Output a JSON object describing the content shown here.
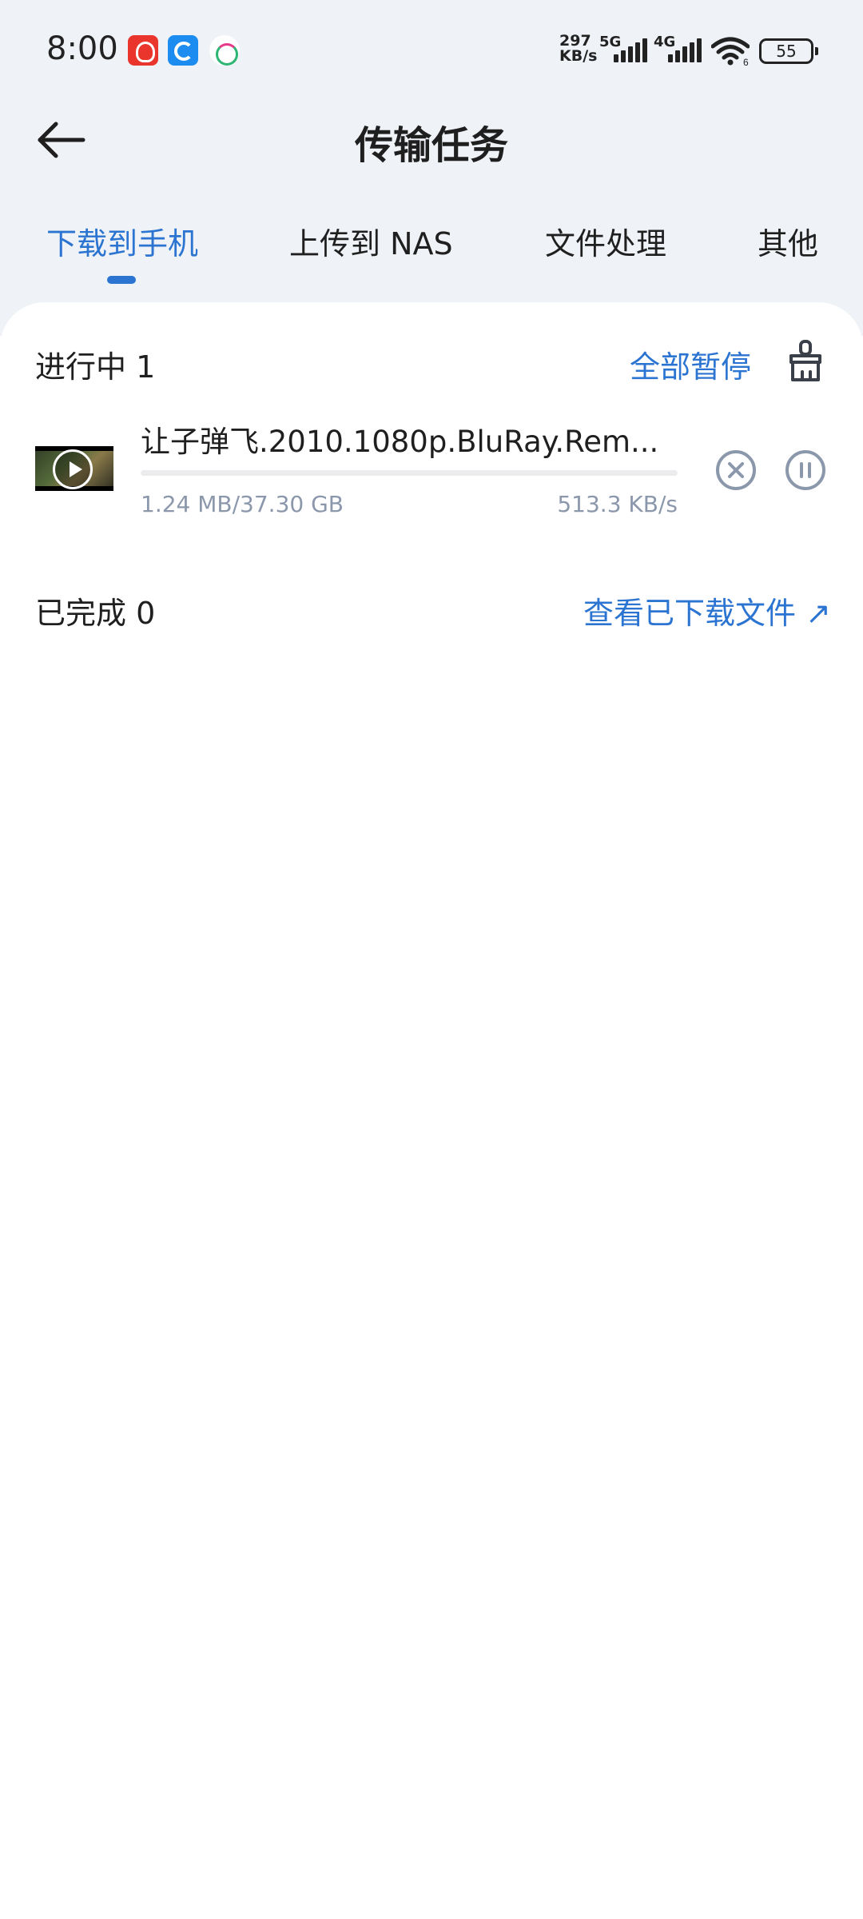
{
  "status_bar": {
    "time": "8:00",
    "net_speed_value": "297",
    "net_speed_unit": "KB/s",
    "sim1_label": "5G",
    "sim2_label": "4G",
    "wifi_slot": "6",
    "battery": "55"
  },
  "header": {
    "title": "传输任务"
  },
  "tabs": [
    {
      "label": "下载到手机",
      "active": true
    },
    {
      "label": "上传到 NAS",
      "active": false
    },
    {
      "label": "文件处理",
      "active": false
    },
    {
      "label": "其他",
      "active": false
    }
  ],
  "in_progress": {
    "title": "进行中 1",
    "pause_all_label": "全部暂停",
    "clean_icon": "broom-icon",
    "tasks": [
      {
        "name": "让子弹飞.2010.1080p.BluRay.Rem...",
        "size_text": "1.24 MB/37.30 GB",
        "speed_text": "513.3 KB/s",
        "progress_fraction": 3e-05
      }
    ]
  },
  "completed": {
    "title": "已完成 0",
    "view_link": "查看已下载文件 ↗"
  },
  "colors": {
    "accent": "#2b74d1",
    "header_bg": "#eff2f7",
    "muted_text": "#8b97ab"
  }
}
